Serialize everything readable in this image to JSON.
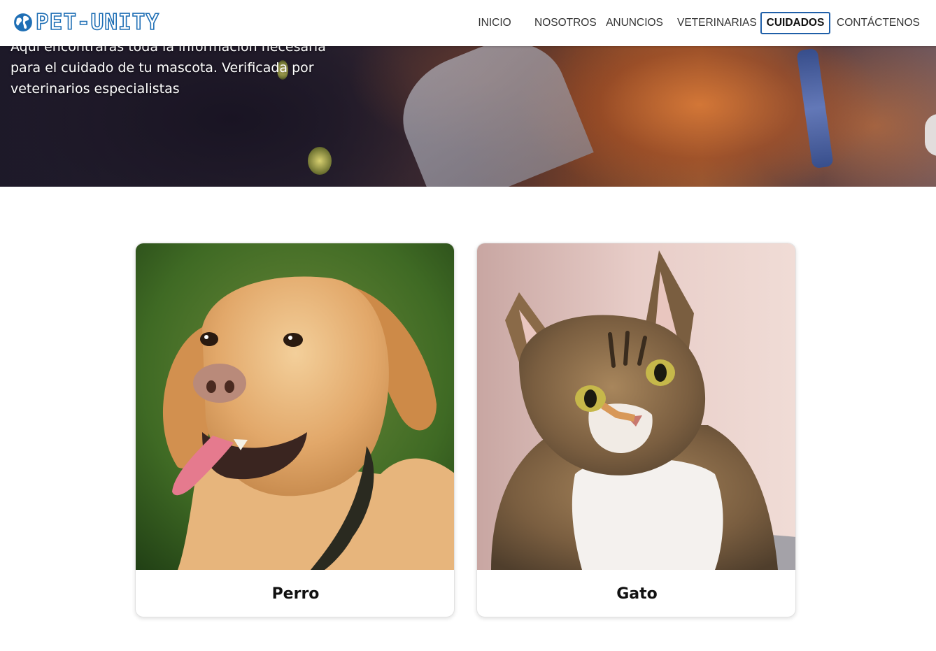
{
  "brand": {
    "name": "PET-UNITY",
    "icon": "globe-icon",
    "color": "#1f6fb5"
  },
  "nav": {
    "items": [
      {
        "label": "INICIO",
        "active": false
      },
      {
        "label": "NOSOTROS",
        "active": false
      },
      {
        "label": "ANUNCIOS",
        "active": false
      },
      {
        "label": "VETERINARIAS",
        "active": false
      },
      {
        "label": "CUIDADOS",
        "active": true
      },
      {
        "label": "CONTÁCTENOS",
        "active": false
      }
    ],
    "active_color": "#1f5fa8"
  },
  "hero": {
    "text": "Aquí encontrarás toda la información necesaria para el cuidado de tu mascota. Verificada por veterinarios especialistas"
  },
  "cards": [
    {
      "label": "Perro",
      "image": "dog-photo"
    },
    {
      "label": "Gato",
      "image": "cat-photo"
    }
  ]
}
